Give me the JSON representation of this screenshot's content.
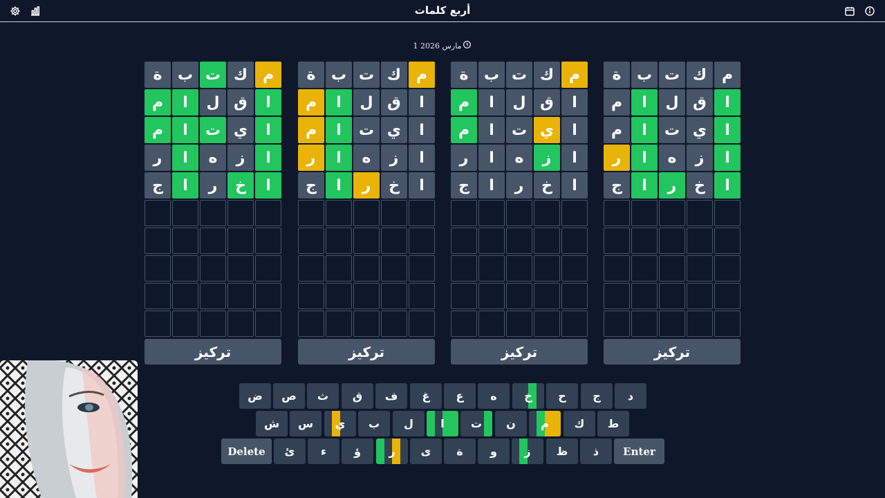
{
  "header": {
    "title": "أربع كلمات",
    "icons": [
      "settings-icon",
      "stats-icon",
      "calendar-icon",
      "info-icon"
    ]
  },
  "date": "1 مارس 2026",
  "colors": {
    "background": "#0f172a",
    "tile_gray": "#475569",
    "tile_green": "#22c55e",
    "tile_yellow": "#eab308",
    "key_gray": "#334155"
  },
  "boards": [
    {
      "focus_label": "تركيز",
      "rows": [
        [
          {
            "l": "م",
            "s": "yellow"
          },
          {
            "l": "ك",
            "s": "gray"
          },
          {
            "l": "ت",
            "s": "green"
          },
          {
            "l": "ب",
            "s": "gray"
          },
          {
            "l": "ة",
            "s": "gray"
          }
        ],
        [
          {
            "l": "ا",
            "s": "green"
          },
          {
            "l": "ق",
            "s": "gray"
          },
          {
            "l": "ل",
            "s": "gray"
          },
          {
            "l": "ا",
            "s": "green"
          },
          {
            "l": "م",
            "s": "green"
          }
        ],
        [
          {
            "l": "ا",
            "s": "green"
          },
          {
            "l": "ي",
            "s": "gray"
          },
          {
            "l": "ت",
            "s": "green"
          },
          {
            "l": "ا",
            "s": "green"
          },
          {
            "l": "م",
            "s": "green"
          }
        ],
        [
          {
            "l": "ا",
            "s": "green"
          },
          {
            "l": "ز",
            "s": "gray"
          },
          {
            "l": "ه",
            "s": "gray"
          },
          {
            "l": "ا",
            "s": "green"
          },
          {
            "l": "ر",
            "s": "gray"
          }
        ],
        [
          {
            "l": "ا",
            "s": "green"
          },
          {
            "l": "خ",
            "s": "green"
          },
          {
            "l": "ر",
            "s": "gray"
          },
          {
            "l": "ا",
            "s": "green"
          },
          {
            "l": "ج",
            "s": "gray"
          }
        ]
      ]
    },
    {
      "focus_label": "تركيز",
      "rows": [
        [
          {
            "l": "م",
            "s": "yellow"
          },
          {
            "l": "ك",
            "s": "gray"
          },
          {
            "l": "ت",
            "s": "gray"
          },
          {
            "l": "ب",
            "s": "gray"
          },
          {
            "l": "ة",
            "s": "gray"
          }
        ],
        [
          {
            "l": "ا",
            "s": "gray"
          },
          {
            "l": "ق",
            "s": "gray"
          },
          {
            "l": "ل",
            "s": "gray"
          },
          {
            "l": "ا",
            "s": "green"
          },
          {
            "l": "م",
            "s": "yellow"
          }
        ],
        [
          {
            "l": "ا",
            "s": "gray"
          },
          {
            "l": "ي",
            "s": "gray"
          },
          {
            "l": "ت",
            "s": "gray"
          },
          {
            "l": "ا",
            "s": "green"
          },
          {
            "l": "م",
            "s": "yellow"
          }
        ],
        [
          {
            "l": "ا",
            "s": "gray"
          },
          {
            "l": "ز",
            "s": "gray"
          },
          {
            "l": "ه",
            "s": "gray"
          },
          {
            "l": "ا",
            "s": "green"
          },
          {
            "l": "ر",
            "s": "yellow"
          }
        ],
        [
          {
            "l": "ا",
            "s": "gray"
          },
          {
            "l": "خ",
            "s": "gray"
          },
          {
            "l": "ر",
            "s": "yellow"
          },
          {
            "l": "ا",
            "s": "green"
          },
          {
            "l": "ج",
            "s": "gray"
          }
        ]
      ]
    },
    {
      "focus_label": "تركيز",
      "rows": [
        [
          {
            "l": "م",
            "s": "yellow"
          },
          {
            "l": "ك",
            "s": "gray"
          },
          {
            "l": "ت",
            "s": "gray"
          },
          {
            "l": "ب",
            "s": "gray"
          },
          {
            "l": "ة",
            "s": "gray"
          }
        ],
        [
          {
            "l": "ا",
            "s": "gray"
          },
          {
            "l": "ق",
            "s": "gray"
          },
          {
            "l": "ل",
            "s": "gray"
          },
          {
            "l": "ا",
            "s": "gray"
          },
          {
            "l": "م",
            "s": "green"
          }
        ],
        [
          {
            "l": "ا",
            "s": "gray"
          },
          {
            "l": "ي",
            "s": "yellow"
          },
          {
            "l": "ت",
            "s": "gray"
          },
          {
            "l": "ا",
            "s": "gray"
          },
          {
            "l": "م",
            "s": "green"
          }
        ],
        [
          {
            "l": "ا",
            "s": "gray"
          },
          {
            "l": "ز",
            "s": "green"
          },
          {
            "l": "ه",
            "s": "gray"
          },
          {
            "l": "ا",
            "s": "gray"
          },
          {
            "l": "ر",
            "s": "gray"
          }
        ],
        [
          {
            "l": "ا",
            "s": "gray"
          },
          {
            "l": "خ",
            "s": "gray"
          },
          {
            "l": "ر",
            "s": "gray"
          },
          {
            "l": "ا",
            "s": "gray"
          },
          {
            "l": "ج",
            "s": "gray"
          }
        ]
      ]
    },
    {
      "focus_label": "تركيز",
      "rows": [
        [
          {
            "l": "م",
            "s": "gray"
          },
          {
            "l": "ك",
            "s": "gray"
          },
          {
            "l": "ت",
            "s": "gray"
          },
          {
            "l": "ب",
            "s": "gray"
          },
          {
            "l": "ة",
            "s": "gray"
          }
        ],
        [
          {
            "l": "ا",
            "s": "green"
          },
          {
            "l": "ق",
            "s": "gray"
          },
          {
            "l": "ل",
            "s": "gray"
          },
          {
            "l": "ا",
            "s": "green"
          },
          {
            "l": "م",
            "s": "gray"
          }
        ],
        [
          {
            "l": "ا",
            "s": "green"
          },
          {
            "l": "ي",
            "s": "gray"
          },
          {
            "l": "ت",
            "s": "gray"
          },
          {
            "l": "ا",
            "s": "green"
          },
          {
            "l": "م",
            "s": "gray"
          }
        ],
        [
          {
            "l": "ا",
            "s": "green"
          },
          {
            "l": "ز",
            "s": "gray"
          },
          {
            "l": "ه",
            "s": "gray"
          },
          {
            "l": "ا",
            "s": "green"
          },
          {
            "l": "ر",
            "s": "yellow"
          }
        ],
        [
          {
            "l": "ا",
            "s": "green"
          },
          {
            "l": "خ",
            "s": "gray"
          },
          {
            "l": "ر",
            "s": "green"
          },
          {
            "l": "ا",
            "s": "green"
          },
          {
            "l": "ج",
            "s": "gray"
          }
        ]
      ]
    }
  ],
  "keyboard": {
    "rows": [
      [
        {
          "label": "د"
        },
        {
          "label": "ج"
        },
        {
          "label": "ح"
        },
        {
          "label": "خ",
          "states": [
            "gray",
            "green",
            "gray",
            "gray"
          ]
        },
        {
          "label": "ه"
        },
        {
          "label": "ع"
        },
        {
          "label": "غ"
        },
        {
          "label": "ف"
        },
        {
          "label": "ق"
        },
        {
          "label": "ث"
        },
        {
          "label": "ص"
        },
        {
          "label": "ض"
        }
      ],
      [
        {
          "label": "ط"
        },
        {
          "label": "ك"
        },
        {
          "label": "م",
          "states": [
            "yellow",
            "yellow",
            "green",
            "gray"
          ]
        },
        {
          "label": "ن"
        },
        {
          "label": "ت",
          "states": [
            "green",
            "gray",
            "gray",
            "gray"
          ]
        },
        {
          "label": "ا",
          "states": [
            "green",
            "green",
            "gray",
            "green"
          ]
        },
        {
          "label": "ل"
        },
        {
          "label": "ب"
        },
        {
          "label": "ي",
          "states": [
            "gray",
            "gray",
            "yellow",
            "gray"
          ]
        },
        {
          "label": "س"
        },
        {
          "label": "ش"
        }
      ],
      [
        {
          "label": "Enter"
        },
        {
          "label": "ذ"
        },
        {
          "label": "ظ"
        },
        {
          "label": "ز",
          "states": [
            "gray",
            "gray",
            "green",
            "gray"
          ]
        },
        {
          "label": "و"
        },
        {
          "label": "ة"
        },
        {
          "label": "ى"
        },
        {
          "label": "ر",
          "states": [
            "gray",
            "yellow",
            "gray",
            "green"
          ]
        },
        {
          "label": "ؤ"
        },
        {
          "label": "ء"
        },
        {
          "label": "ئ"
        },
        {
          "label": "Delete"
        }
      ]
    ]
  }
}
